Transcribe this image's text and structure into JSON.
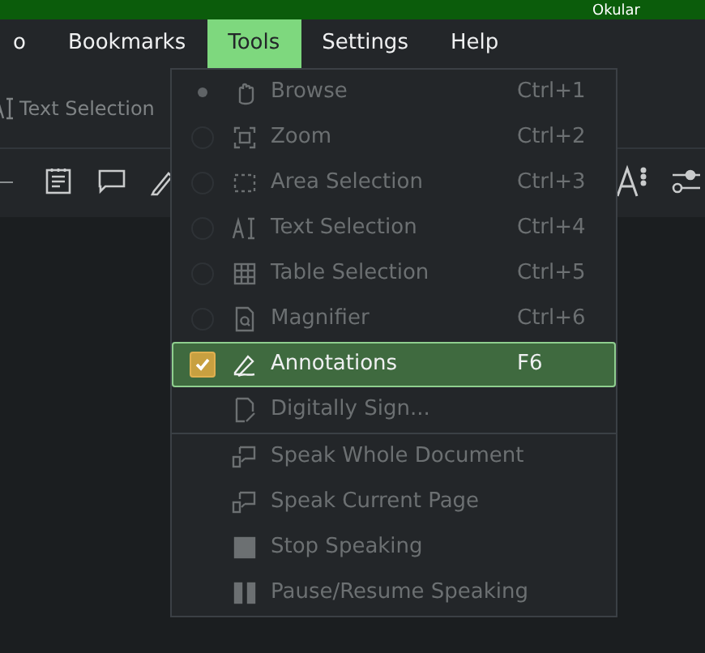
{
  "window": {
    "title": "Okular"
  },
  "menu_bar": [
    {
      "label": "o",
      "selected": false
    },
    {
      "label": "Bookmarks",
      "selected": false
    },
    {
      "label": "Tools",
      "selected": true
    },
    {
      "label": "Settings",
      "selected": false
    },
    {
      "label": "Help",
      "selected": false
    }
  ],
  "toolbar": {
    "mode_button": "Text Selection"
  },
  "tools_menu": [
    {
      "kind": "radio",
      "label": "Browse",
      "shortcut": "Ctrl+1",
      "selected": true,
      "disabled": true,
      "highlighted": false
    },
    {
      "kind": "radio",
      "label": "Zoom",
      "shortcut": "Ctrl+2",
      "selected": false,
      "disabled": true,
      "highlighted": false
    },
    {
      "kind": "radio",
      "label": "Area Selection",
      "shortcut": "Ctrl+3",
      "selected": false,
      "disabled": true,
      "highlighted": false
    },
    {
      "kind": "radio",
      "label": "Text Selection",
      "shortcut": "Ctrl+4",
      "selected": false,
      "disabled": true,
      "highlighted": false
    },
    {
      "kind": "radio",
      "label": "Table Selection",
      "shortcut": "Ctrl+5",
      "selected": false,
      "disabled": true,
      "highlighted": false
    },
    {
      "kind": "radio",
      "label": "Magnifier",
      "shortcut": "Ctrl+6",
      "selected": false,
      "disabled": true,
      "highlighted": false
    },
    {
      "kind": "check",
      "label": "Annotations",
      "shortcut": "F6",
      "checked": true,
      "disabled": false,
      "highlighted": true
    },
    {
      "kind": "plain",
      "label": "Digitally Sign...",
      "disabled": true,
      "highlighted": false
    },
    {
      "kind": "separator"
    },
    {
      "kind": "plain",
      "label": "Speak Whole Document",
      "disabled": true,
      "highlighted": false
    },
    {
      "kind": "plain",
      "label": "Speak Current Page",
      "disabled": true,
      "highlighted": false
    },
    {
      "kind": "plain",
      "label": "Stop Speaking",
      "disabled": true,
      "highlighted": false
    },
    {
      "kind": "plain",
      "label": "Pause/Resume Speaking",
      "disabled": true,
      "highlighted": false
    }
  ]
}
